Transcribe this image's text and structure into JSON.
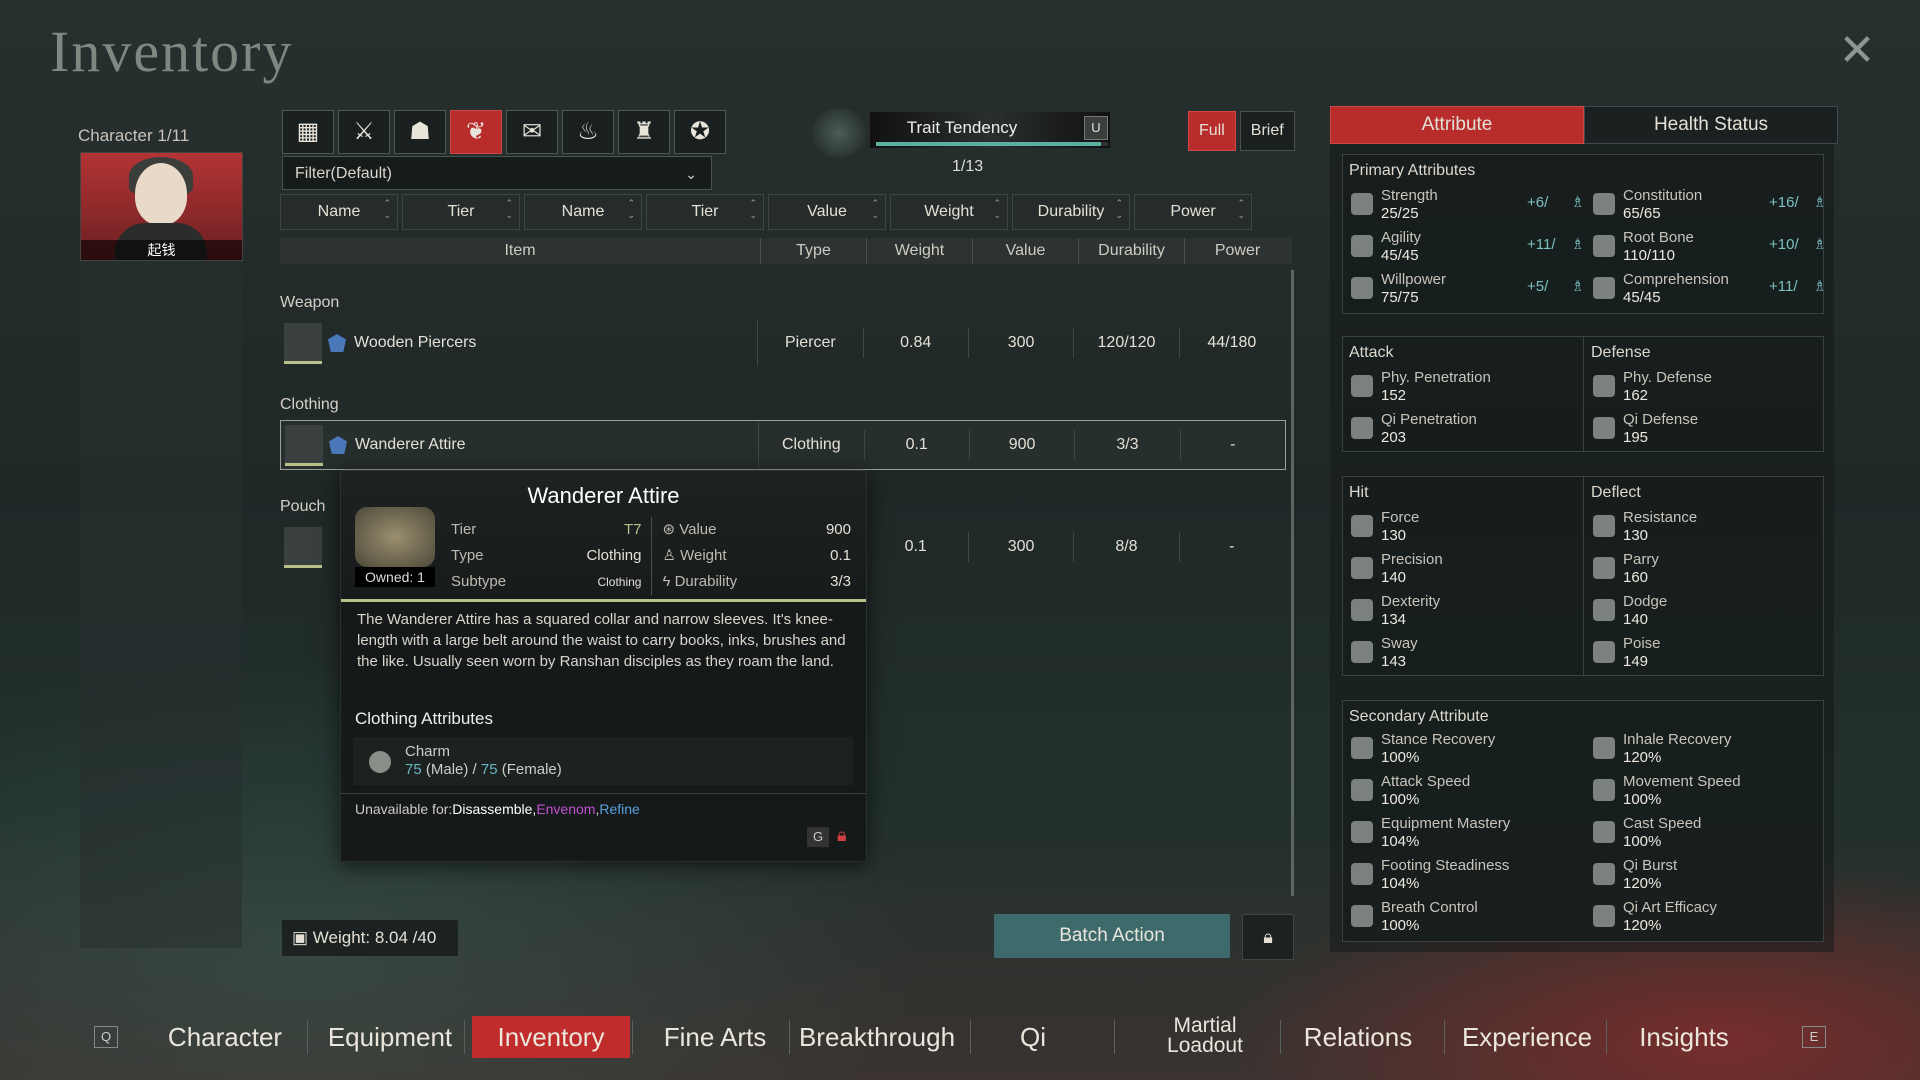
{
  "page": {
    "title": "Inventory",
    "close_icon": "close-x-icon"
  },
  "character": {
    "label": "Character 1/11",
    "name": "起钱"
  },
  "category_tabs": [
    {
      "icon": "grid-icon",
      "glyph": "▦",
      "active": false
    },
    {
      "icon": "weapon-icon",
      "glyph": "⚔",
      "active": false
    },
    {
      "icon": "clothing-icon",
      "glyph": "☗",
      "active": false
    },
    {
      "icon": "accessory-icon",
      "glyph": "❦",
      "active": true
    },
    {
      "icon": "manual-icon",
      "glyph": "✉",
      "active": false
    },
    {
      "icon": "food-icon",
      "glyph": "♨",
      "active": false
    },
    {
      "icon": "pouch-icon",
      "glyph": "♜",
      "active": false
    },
    {
      "icon": "misc-icon",
      "glyph": "✪",
      "active": false
    }
  ],
  "filter": {
    "label": "Filter(Default)"
  },
  "trait": {
    "label": "Trait Tendency",
    "key": "U",
    "count": "1/13",
    "progress": 0.97
  },
  "view": {
    "full": "Full",
    "brief": "Brief"
  },
  "sort_buttons": [
    "Name",
    "Tier",
    "Name",
    "Tier",
    "Value",
    "Weight",
    "Durability",
    "Power"
  ],
  "table": {
    "headers": [
      "Item",
      "Type",
      "Weight",
      "Value",
      "Durability",
      "Power"
    ],
    "sections": [
      {
        "name": "Weapon",
        "rows": [
          {
            "item": "Wooden Piercers",
            "type": "Piercer",
            "weight": "0.84",
            "value": "300",
            "durability": "120/120",
            "power": "44/180"
          }
        ]
      },
      {
        "name": "Clothing",
        "rows": [
          {
            "item": "Wanderer Attire",
            "type": "Clothing",
            "weight": "0.1",
            "value": "900",
            "durability": "3/3",
            "power": "-"
          }
        ]
      },
      {
        "name": "Pouch",
        "rows": [
          {
            "item": "",
            "type": "",
            "weight": "0.1",
            "value": "300",
            "durability": "8/8",
            "power": "-"
          }
        ]
      }
    ]
  },
  "tooltip": {
    "name": "Wanderer Attire",
    "owned": "Owned: 1",
    "tier_k": "Tier",
    "tier_v": "T7",
    "type_k": "Type",
    "type_v": "Clothing",
    "subtype_k": "Subtype",
    "subtype_v": "Clothing",
    "value_k": "Value",
    "value_v": "900",
    "weight_k": "Weight",
    "weight_v": "0.1",
    "durability_k": "Durability",
    "durability_v": "3/3",
    "description": "The Wanderer Attire has a squared collar and narrow sleeves. It's knee-length with a large belt around the waist to carry books, inks, brushes and the like. Usually seen worn by Ranshan disciples as they roam the land.",
    "attr_title": "Clothing Attributes",
    "charm_label": "Charm",
    "charm_male": "75",
    "male": "(Male)",
    "slash": "/",
    "charm_female": "75",
    "female": "(Female)",
    "unavail_label": "Unavailable for:",
    "unavail_1": "Disassemble,",
    "unavail_2": "Envenom",
    "unavail_comma": ",",
    "unavail_3": "Refine",
    "key_g": "G"
  },
  "weight": {
    "label": "Weight: 8.04 /40"
  },
  "batch": {
    "label": "Batch Action"
  },
  "right_tabs": {
    "attribute": "Attribute",
    "health": "Health Status"
  },
  "primary": {
    "title": "Primary Attributes",
    "items": [
      {
        "name": "Strength",
        "value": "25/25",
        "bonus": "+6/"
      },
      {
        "name": "Constitution",
        "value": "65/65",
        "bonus": "+16/"
      },
      {
        "name": "Agility",
        "value": "45/45",
        "bonus": "+11/"
      },
      {
        "name": "Root Bone",
        "value": "110/110",
        "bonus": "+10/"
      },
      {
        "name": "Willpower",
        "value": "75/75",
        "bonus": "+5/"
      },
      {
        "name": "Comprehension",
        "value": "45/45",
        "bonus": "+11/"
      }
    ]
  },
  "attack": {
    "title": "Attack",
    "items": [
      {
        "name": "Phy. Penetration",
        "value": "152"
      },
      {
        "name": "Qi Penetration",
        "value": "203"
      }
    ]
  },
  "defense": {
    "title": "Defense",
    "items": [
      {
        "name": "Phy. Defense",
        "value": "162"
      },
      {
        "name": "Qi Defense",
        "value": "195"
      }
    ]
  },
  "hit": {
    "title": "Hit",
    "items": [
      {
        "name": "Force",
        "value": "130"
      },
      {
        "name": "Precision",
        "value": "140"
      },
      {
        "name": "Dexterity",
        "value": "134"
      },
      {
        "name": "Sway",
        "value": "143"
      }
    ]
  },
  "deflect": {
    "title": "Deflect",
    "items": [
      {
        "name": "Resistance",
        "value": "130"
      },
      {
        "name": "Parry",
        "value": "160"
      },
      {
        "name": "Dodge",
        "value": "140"
      },
      {
        "name": "Poise",
        "value": "149"
      }
    ]
  },
  "secondary": {
    "title": "Secondary Attribute",
    "items": [
      {
        "name": "Stance Recovery",
        "value": "100%"
      },
      {
        "name": "Inhale Recovery",
        "value": "120%"
      },
      {
        "name": "Attack Speed",
        "value": "100%"
      },
      {
        "name": "Movement Speed",
        "value": "100%"
      },
      {
        "name": "Equipment Mastery",
        "value": "104%"
      },
      {
        "name": "Cast Speed",
        "value": "100%"
      },
      {
        "name": "Footing Steadiness",
        "value": "104%"
      },
      {
        "name": "Qi Burst",
        "value": "120%"
      },
      {
        "name": "Breath Control",
        "value": "100%"
      },
      {
        "name": "Qi Art Efficacy",
        "value": "120%"
      }
    ]
  },
  "nav": {
    "left_key": "Q",
    "right_key": "E",
    "items": [
      "Character",
      "Equipment",
      "Inventory",
      "Fine Arts",
      "Breakthrough",
      "Qi",
      "Martial Loadout",
      "Relations",
      "Experience",
      "Insights"
    ],
    "active": "Inventory"
  },
  "colors": {
    "accent_red": "#b82c2c",
    "teal": "#3f6a6c",
    "tier_green": "#b9c08a"
  }
}
